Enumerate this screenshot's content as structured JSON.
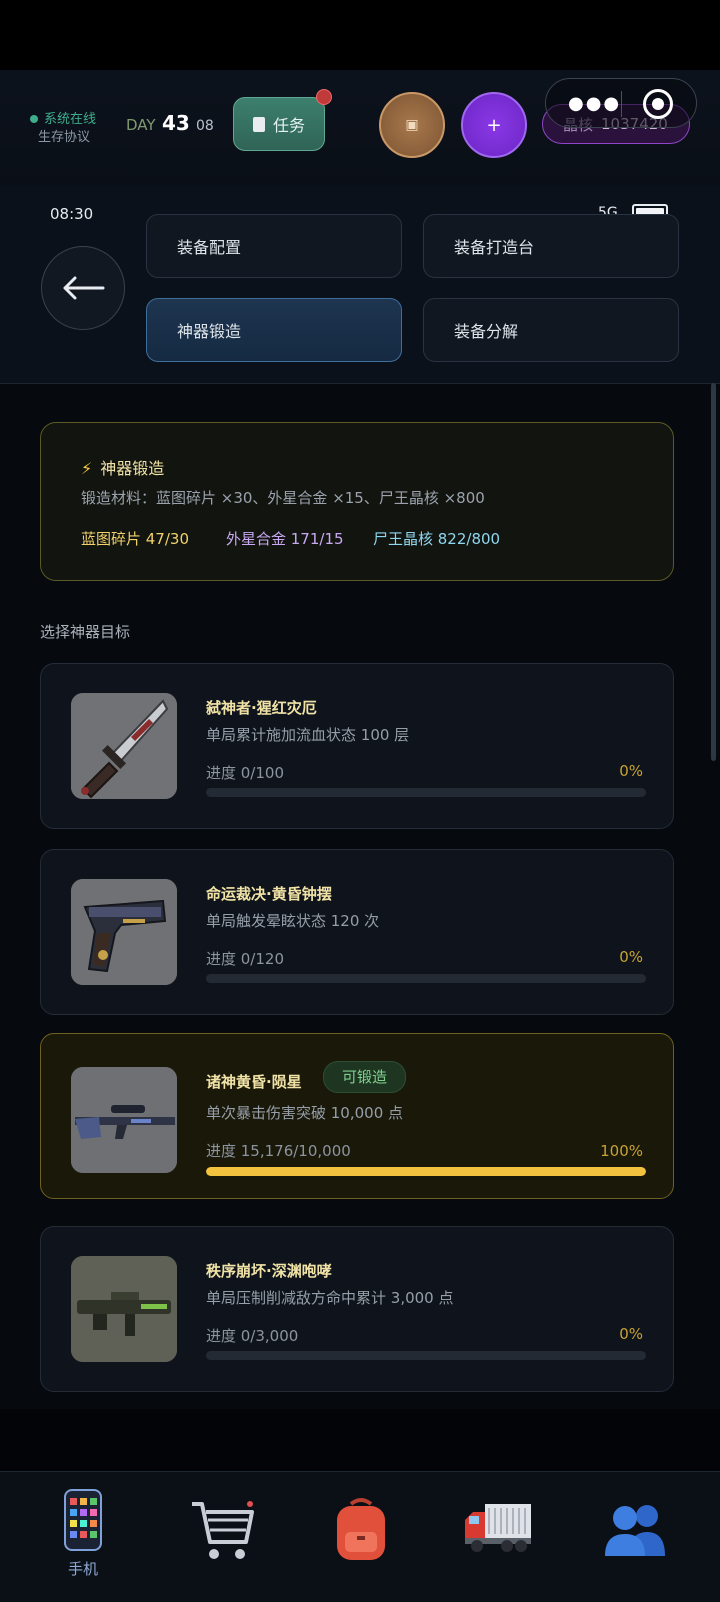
{
  "hud": {
    "status_online": "系统在线",
    "protocol": "生存协议",
    "day_label": "DAY",
    "day_number": "43",
    "day_sub": "08",
    "task_label": "任务",
    "crystal_label": "晶核",
    "crystal_value": "1037420"
  },
  "phone": {
    "time": "08:30",
    "network": "5G"
  },
  "nav": {
    "items": [
      {
        "label": "装备配置"
      },
      {
        "label": "装备打造台"
      },
      {
        "label": "神器锻造"
      },
      {
        "label": "装备分解"
      }
    ],
    "active": "神器锻造"
  },
  "forge": {
    "title": "神器锻造",
    "materials": "锻造材料：蓝图碎片 ×30、外星合金 ×15、尸王晶核 ×800",
    "progress": [
      {
        "text": "蓝图碎片 47/30",
        "color": "#f1d26c"
      },
      {
        "text": "外星合金 171/15",
        "color": "#c9a9f2"
      },
      {
        "text": "尸王晶核 822/800",
        "color": "#8fd6ef"
      }
    ]
  },
  "select_title": "选择神器目标",
  "artifacts": [
    {
      "name": "弑神者·猩红灾厄",
      "desc": "单局累计施加流血状态 100 层",
      "progress": "进度 0/100",
      "percent": "0%",
      "fill": 0,
      "ready": false,
      "icon": "knife-icon"
    },
    {
      "name": "命运裁决·黄昏钟摆",
      "desc": "单局触发晕眩状态 120 次",
      "progress": "进度 0/120",
      "percent": "0%",
      "fill": 0,
      "ready": false,
      "icon": "pistol-icon"
    },
    {
      "name": "诸神黄昏·陨星",
      "desc": "单次暴击伤害突破 10,000 点",
      "progress": "进度 15,176/10,000",
      "percent": "100%",
      "fill": 1,
      "ready": true,
      "badge": "可锻造",
      "icon": "sniper-rifle-icon"
    },
    {
      "name": "秩序崩坏·深渊咆哮",
      "desc": "单局压制削减敌方命中累计 3,000 点",
      "progress": "进度 0/3,000",
      "percent": "0%",
      "fill": 0,
      "ready": false,
      "icon": "heavy-rifle-icon"
    }
  ],
  "bottom_nav": [
    {
      "label": "手机",
      "icon": "phone-icon"
    },
    {
      "label": "",
      "icon": "cart-icon"
    },
    {
      "label": "",
      "icon": "backpack-icon"
    },
    {
      "label": "",
      "icon": "truck-icon"
    },
    {
      "label": "",
      "icon": "people-icon"
    }
  ]
}
